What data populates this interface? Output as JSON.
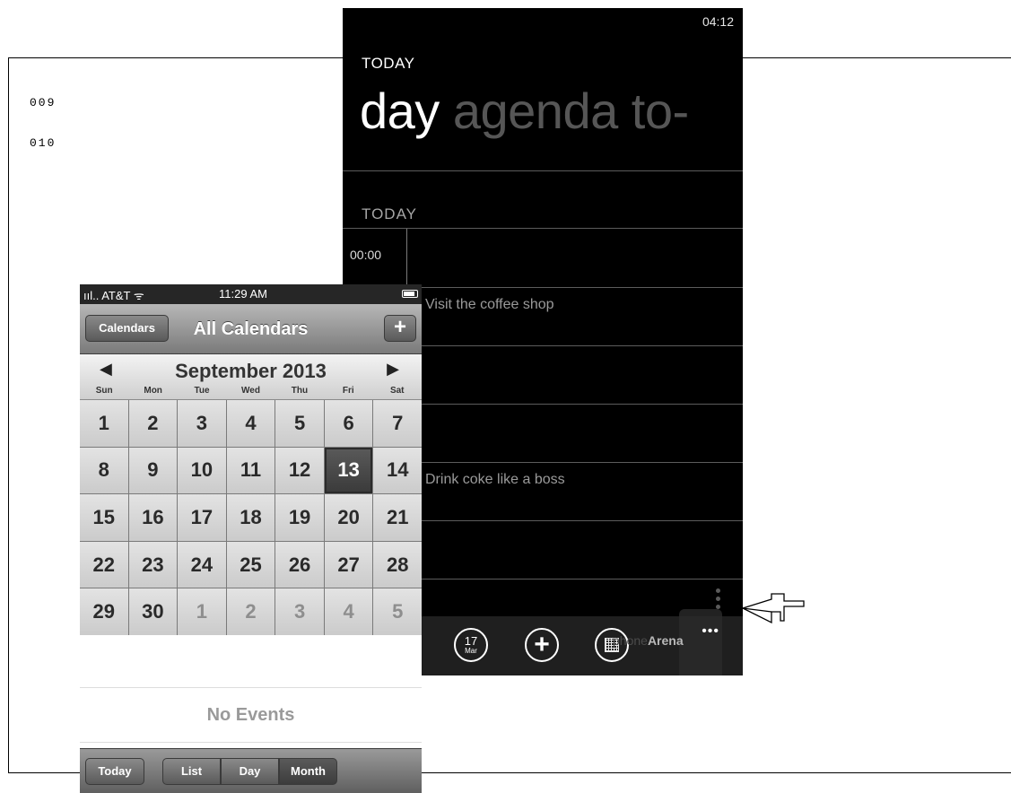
{
  "figure": {
    "line_numbers": [
      "009",
      "010"
    ]
  },
  "windows_phone": {
    "clock": "04:12",
    "title": "TODAY",
    "pivot": {
      "active": "day",
      "inactive": "agenda to-"
    },
    "section": "TODAY",
    "time_slot": "00:00",
    "events": [
      "Visit the coffee shop",
      "Drink coke like a boss"
    ],
    "appbar": {
      "date_day": "17",
      "date_month": "Mar",
      "add_icon": "plus-circle-icon",
      "calendar_icon": "calendar-icon",
      "more": "•••"
    },
    "watermark": {
      "prefix": "phone",
      "brand": "Arena"
    }
  },
  "iphone": {
    "status": {
      "carrier": "ııl.. AT&T ᯤ",
      "time": "11:29 AM"
    },
    "nav": {
      "left_button": "Calendars",
      "title": "All Calendars",
      "right_button": "+"
    },
    "month_title": "September 2013",
    "prev_arrow": "◀",
    "next_arrow": "▶",
    "weekdays": [
      "Sun",
      "Mon",
      "Tue",
      "Wed",
      "Thu",
      "Fri",
      "Sat"
    ],
    "days": [
      {
        "d": "1"
      },
      {
        "d": "2"
      },
      {
        "d": "3"
      },
      {
        "d": "4"
      },
      {
        "d": "5"
      },
      {
        "d": "6"
      },
      {
        "d": "7"
      },
      {
        "d": "8"
      },
      {
        "d": "9"
      },
      {
        "d": "10"
      },
      {
        "d": "11"
      },
      {
        "d": "12"
      },
      {
        "d": "13",
        "selected": true
      },
      {
        "d": "14"
      },
      {
        "d": "15"
      },
      {
        "d": "16"
      },
      {
        "d": "17"
      },
      {
        "d": "18"
      },
      {
        "d": "19"
      },
      {
        "d": "20"
      },
      {
        "d": "21"
      },
      {
        "d": "22"
      },
      {
        "d": "23"
      },
      {
        "d": "24"
      },
      {
        "d": "25"
      },
      {
        "d": "26"
      },
      {
        "d": "27"
      },
      {
        "d": "28"
      },
      {
        "d": "29"
      },
      {
        "d": "30"
      },
      {
        "d": "1",
        "muted": true
      },
      {
        "d": "2",
        "muted": true
      },
      {
        "d": "3",
        "muted": true
      },
      {
        "d": "4",
        "muted": true
      },
      {
        "d": "5",
        "muted": true
      }
    ],
    "no_events": "No Events",
    "toolbar": {
      "today": "Today",
      "list": "List",
      "day": "Day",
      "month": "Month"
    }
  }
}
